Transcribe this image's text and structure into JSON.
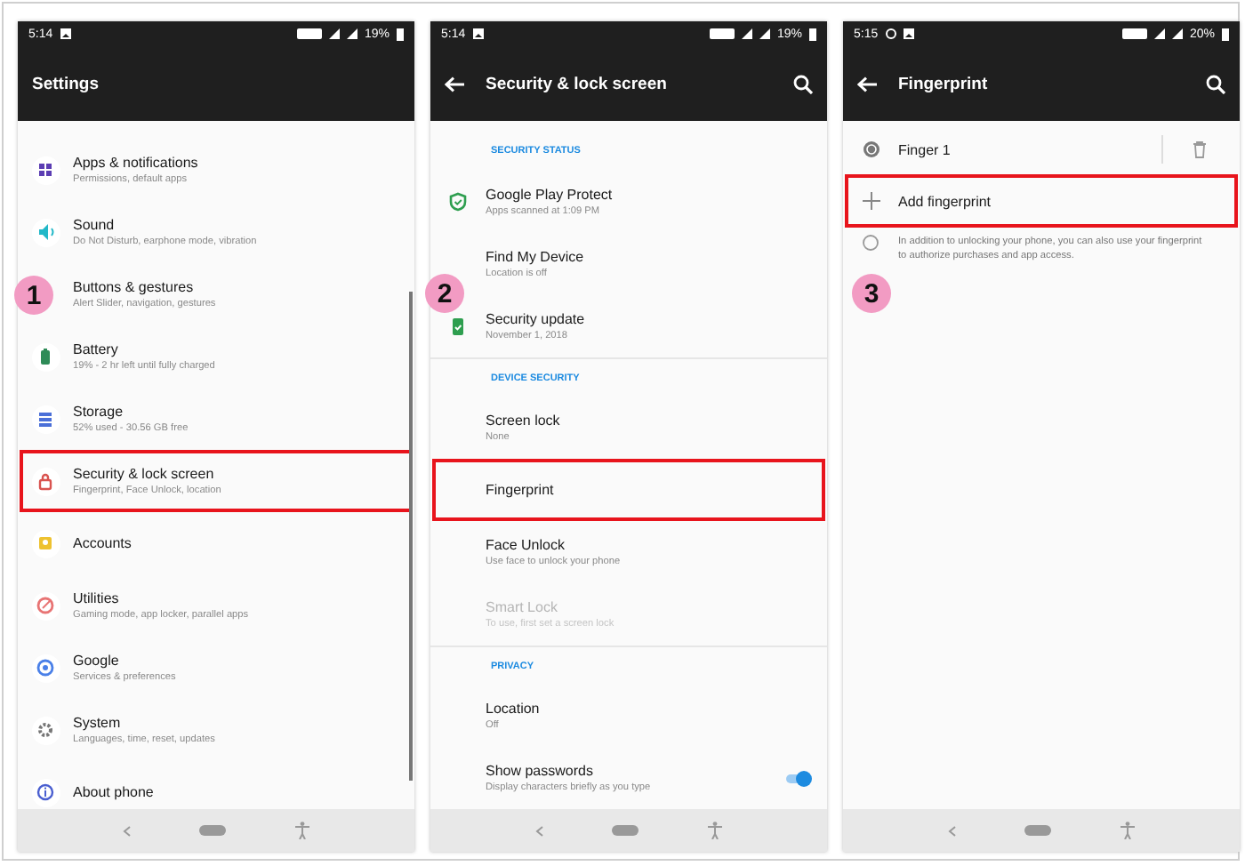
{
  "screens": [
    {
      "status": {
        "time": "5:14",
        "battery": "19%"
      },
      "header": {
        "title": "Settings",
        "back": false,
        "search": false
      },
      "step": "1",
      "items": [
        {
          "kind": "item",
          "title": "Apps & notifications",
          "subtitle": "Permissions, default apps",
          "color": "#5b3db3",
          "highlighted": false
        },
        {
          "kind": "item",
          "title": "Sound",
          "subtitle": "Do Not Disturb, earphone mode, vibration",
          "color": "#22b8c8",
          "highlighted": false
        },
        {
          "kind": "item",
          "title": "Buttons & gestures",
          "subtitle": "Alert Slider, navigation, gestures",
          "highlighted": false
        },
        {
          "kind": "item",
          "title": "Battery",
          "subtitle": "19% - 2 hr left until fully charged",
          "color": "#2e8b57",
          "highlighted": false
        },
        {
          "kind": "item",
          "title": "Storage",
          "subtitle": "52% used - 30.56 GB free",
          "color": "#4a6fd8",
          "highlighted": false
        },
        {
          "kind": "item",
          "title": "Security & lock screen",
          "subtitle": "Fingerprint, Face Unlock, location",
          "color": "#d9534f",
          "highlighted": true
        },
        {
          "kind": "item",
          "title": "Accounts",
          "color": "#eec230",
          "highlighted": false
        },
        {
          "kind": "item",
          "title": "Utilities",
          "subtitle": "Gaming mode, app locker, parallel apps",
          "color": "#e87474",
          "highlighted": false
        },
        {
          "kind": "item",
          "title": "Google",
          "subtitle": "Services & preferences",
          "color": "#4a80e8",
          "highlighted": false
        },
        {
          "kind": "item",
          "title": "System",
          "subtitle": "Languages, time, reset, updates",
          "color": "#777777",
          "highlighted": false
        },
        {
          "kind": "item",
          "title": "About phone",
          "color": "#4a5fd0",
          "highlighted": false
        }
      ]
    },
    {
      "status": {
        "time": "5:14",
        "battery": "19%"
      },
      "header": {
        "title": "Security & lock screen",
        "back": true,
        "search": true
      },
      "step": "2",
      "items": [
        {
          "kind": "heading",
          "title": "SECURITY STATUS"
        },
        {
          "kind": "item",
          "title": "Google Play Protect",
          "subtitle": "Apps scanned at 1:09 PM",
          "color": "#2e9e4f",
          "highlighted": false,
          "disabled": false
        },
        {
          "kind": "item",
          "title": "Find My Device",
          "subtitle": "Location is off",
          "highlighted": false,
          "disabled": false
        },
        {
          "kind": "item",
          "title": "Security update",
          "subtitle": "November 1, 2018",
          "color": "#2e9e4f",
          "highlighted": false,
          "disabled": false
        },
        {
          "kind": "heading",
          "title": "DEVICE SECURITY"
        },
        {
          "kind": "item",
          "title": "Screen lock",
          "subtitle": "None",
          "highlighted": false,
          "disabled": false
        },
        {
          "kind": "item",
          "title": "Fingerprint",
          "highlighted": true,
          "disabled": false
        },
        {
          "kind": "item",
          "title": "Face Unlock",
          "subtitle": "Use face to unlock your phone",
          "highlighted": false,
          "disabled": false
        },
        {
          "kind": "item",
          "title": "Smart Lock",
          "subtitle": "To use, first set a screen lock",
          "highlighted": false,
          "disabled": true
        },
        {
          "kind": "heading",
          "title": "PRIVACY"
        },
        {
          "kind": "item",
          "title": "Location",
          "subtitle": "Off",
          "highlighted": false,
          "disabled": false
        },
        {
          "kind": "toggle",
          "title": "Show passwords",
          "subtitle": "Display characters briefly as you type",
          "on": true,
          "highlighted": false,
          "disabled": false
        }
      ]
    },
    {
      "status": {
        "time": "5:15",
        "battery": "20%"
      },
      "header": {
        "title": "Fingerprint",
        "back": true,
        "search": true
      },
      "step": "3",
      "items": [
        {
          "kind": "finger",
          "title": "Finger 1",
          "highlighted": false
        },
        {
          "kind": "add",
          "title": "Add fingerprint",
          "highlighted": true
        },
        {
          "kind": "note",
          "title": "In addition to unlocking your phone, you can also use your fingerprint to authorize purchases and app access."
        }
      ]
    }
  ]
}
